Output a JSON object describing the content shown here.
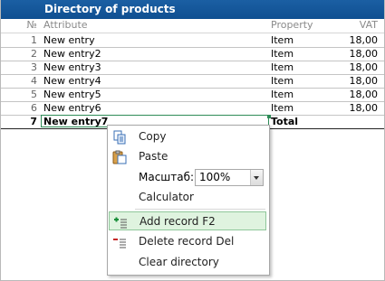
{
  "window": {
    "title": "Directory of products"
  },
  "table": {
    "columns": {
      "num": "№",
      "attribute": "Attribute",
      "property": "Property",
      "vat": "VAT"
    },
    "rows": [
      {
        "num": "1",
        "attribute": "New entry",
        "property": "Item",
        "vat": "18,00"
      },
      {
        "num": "2",
        "attribute": "New entry2",
        "property": "Item",
        "vat": "18,00"
      },
      {
        "num": "3",
        "attribute": "New entry3",
        "property": "Item",
        "vat": "18,00"
      },
      {
        "num": "4",
        "attribute": "New entry4",
        "property": "Item",
        "vat": "18,00"
      },
      {
        "num": "5",
        "attribute": "New entry5",
        "property": "Item",
        "vat": "18,00"
      },
      {
        "num": "6",
        "attribute": "New entry6",
        "property": "Item",
        "vat": "18,00"
      },
      {
        "num": "7",
        "attribute": "New entry7",
        "property": "Total",
        "vat": ""
      }
    ]
  },
  "context_menu": {
    "copy": "Copy",
    "paste": "Paste",
    "zoom_label": "Масштаб:",
    "zoom_value": "100%",
    "calculator": "Calculator",
    "add_record": "Add record  F2",
    "delete_record": "Delete record Del",
    "clear_directory": "Clear directory"
  },
  "colors": {
    "title_bar": "#1565a8",
    "highlight": "#dff3df",
    "edit_border": "#2e8b57"
  },
  "icons": {
    "copy": "copy-icon",
    "paste": "paste-icon",
    "add": "add-record-icon",
    "delete": "delete-record-icon"
  }
}
